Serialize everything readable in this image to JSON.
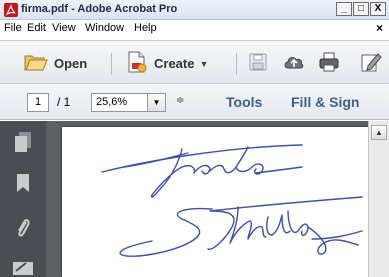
{
  "window": {
    "title": "firma.pdf - Adobe Acrobat Pro",
    "minimize": "_",
    "maximize": "□",
    "close": "X"
  },
  "menubar": {
    "items": [
      "File",
      "Edit",
      "View",
      "Window",
      "Help"
    ],
    "close_doc": "×"
  },
  "toolbar": {
    "open_label": "Open",
    "create_label": "Create",
    "create_caret": "▼"
  },
  "nav": {
    "page_current": "1",
    "page_total": "/ 1",
    "zoom": "25,6%",
    "zoom_caret": "▼",
    "more": "≑",
    "tools_label": "Tools",
    "fill_sign_label": "Fill & Sign"
  },
  "scroll": {
    "up": "▲"
  },
  "colors": {
    "signature_ink": "#3c4fb4",
    "panel_dark": "#4a4d52",
    "doc_bg": "#5d6065",
    "link_blue": "#3f5f88",
    "acrobat_red": "#c8141b"
  },
  "icons": {
    "app": "acrobat-icon",
    "open": "folder-open-icon",
    "create": "create-pdf-icon",
    "save": "save-icon",
    "upload": "cloud-upload-icon",
    "print": "printer-icon",
    "edit": "pencil-edit-icon",
    "pages": "page-thumbnails-icon",
    "bookmarks": "bookmark-icon",
    "attachments": "paperclip-icon",
    "signatures": "signature-icon"
  }
}
